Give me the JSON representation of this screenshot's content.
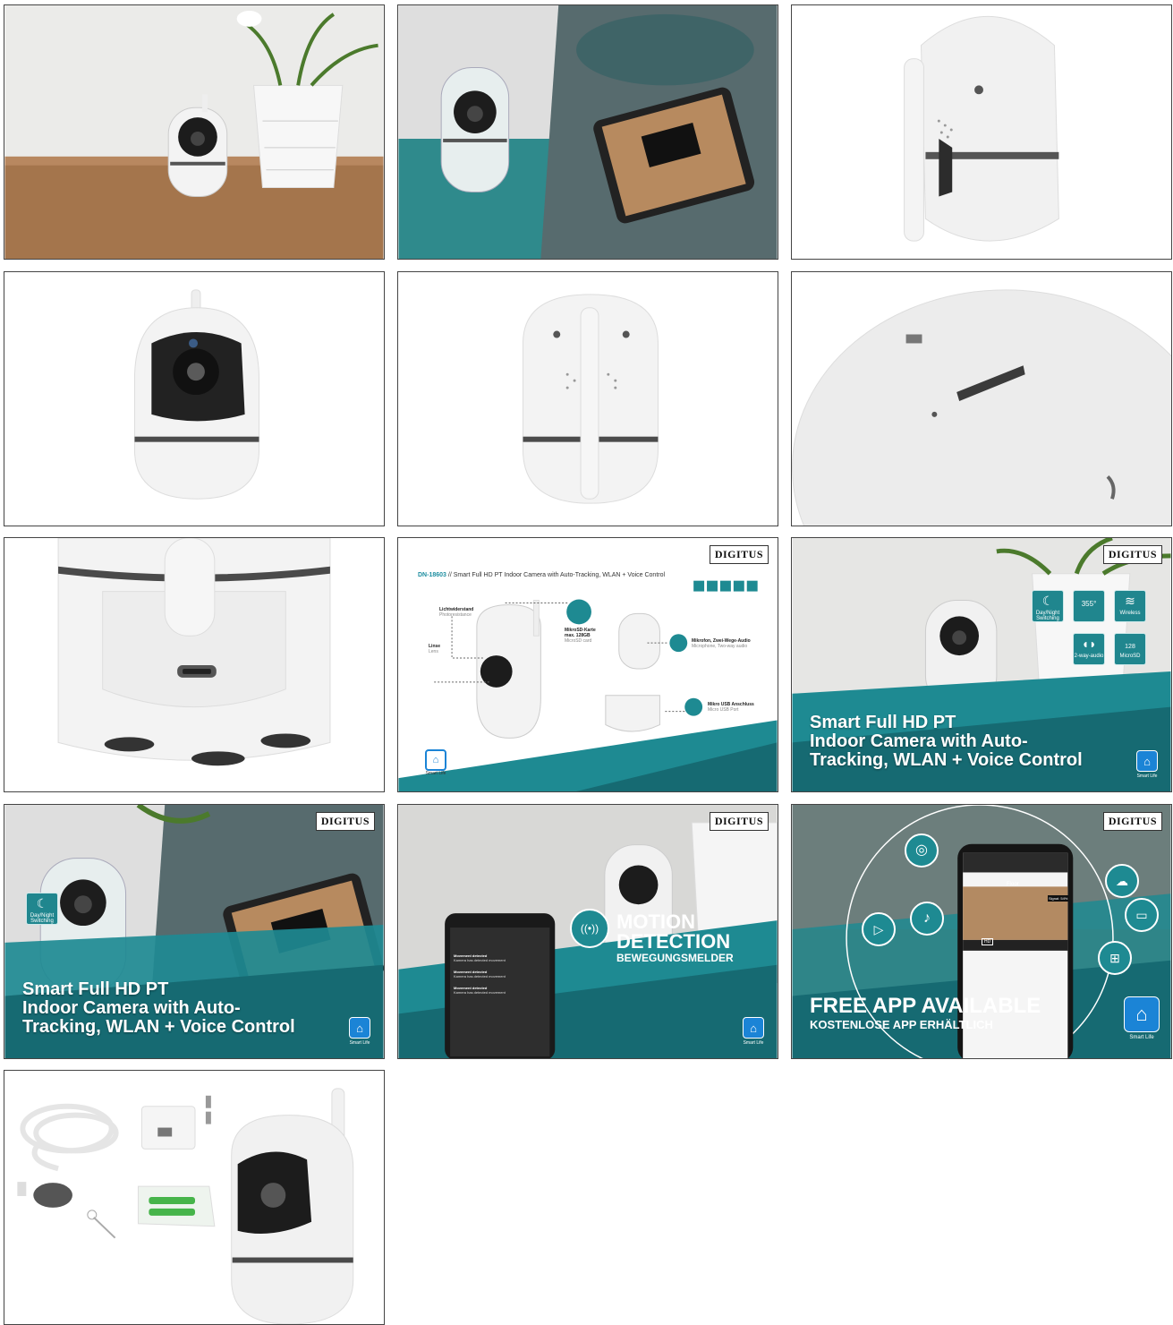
{
  "brand": "DIGITUS",
  "smart_life_label": "Smart Life",
  "headline": {
    "line1": "Smart Full HD PT",
    "line2": "Indoor Camera with Auto-",
    "line3": "Tracking, WLAN + Voice Control"
  },
  "spec_sheet": {
    "model": "DN-18603",
    "separator": "//",
    "title": "Smart Full HD PT Indoor Camera with Auto-Tracking, WLAN + Voice Control",
    "labels": {
      "light_de": "Lichtwiderstand",
      "light_en": "Photoresistance",
      "lens_de": "Linse",
      "lens_en": "Lens",
      "sd_de1": "MikroSD-Karte",
      "sd_de2": "max. 128GB",
      "sd_en": "MicroSD card",
      "mic_de": "Mikrofon, Zwei-Wege-Audio",
      "mic_en": "Microphone, Two-way audio",
      "usb_de": "Mikro USB Anschluss",
      "usb_en": "Micro USB Port"
    }
  },
  "features": {
    "day_night": "Day/Night Switching",
    "rotation": "355°",
    "wireless": "Wireless",
    "two_way_audio": "2-way-audio",
    "microsd": "MicroSD",
    "sd_capacity": "128"
  },
  "motion": {
    "line1": "MOTION",
    "line2": "DETECTION",
    "line3": "BEWEGUNGSMELDER",
    "notif1_title": "Movement detected",
    "notif1_text": "Kamera has detected movement",
    "notif2_title": "Movement detected",
    "notif2_text": "Kamera has detected movement",
    "notif3_title": "Movement detected",
    "notif3_text": "Kamera has detected movement"
  },
  "app": {
    "line1": "FREE APP AVAILABLE",
    "line2": "KOSTENLOSE APP ERHÄLTLICH",
    "screen_title": "Floor",
    "signal": "Signal: 54%",
    "hd": "HD"
  },
  "colors": {
    "teal": "#1e8a92",
    "teal_dark": "#166a72",
    "wood": "#a4754c",
    "camera_white": "#f1f1f1",
    "smart_life_blue": "#1b84d6"
  }
}
